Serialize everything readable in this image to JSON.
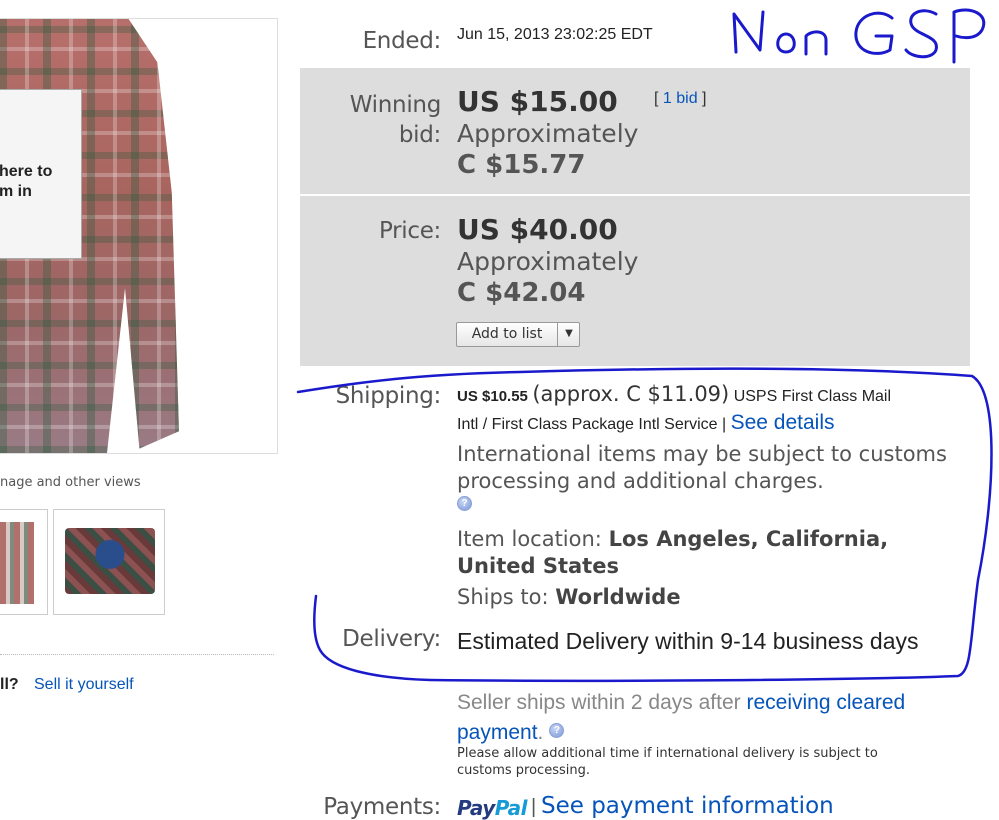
{
  "gallery": {
    "hover_line1": "here to",
    "hover_line2": "m in",
    "views_caption": "nage and other views"
  },
  "sell": {
    "question": "ll?",
    "link": "Sell it yourself"
  },
  "ended": {
    "label": "Ended:",
    "value": "Jun 15, 2013  23:02:25 EDT"
  },
  "bid": {
    "label_line1": "Winning",
    "label_line2": "bid:",
    "amount": "US $15.00",
    "bid_count_open": "[ ",
    "bid_count": "1 bid",
    "bid_count_close": " ]",
    "approx_label": "Approximately",
    "approx_value": "C $15.77"
  },
  "price": {
    "label": "Price:",
    "amount": "US $40.00",
    "approx_label": "Approximately",
    "approx_value": "C $42.04",
    "add_to_list": "Add to list"
  },
  "shipping": {
    "label": "Shipping:",
    "cost": "US $10.55",
    "approx": "(approx. C $11.09)",
    "service_part1": "USPS First Class Mail",
    "service_part2": "Intl / First Class Package Intl Service |",
    "see_details": "See details",
    "intl_note": "International items may be subject to customs processing and additional charges.",
    "location_label": "Item location:",
    "location_line1": "Los Angeles, California,",
    "location_line2": "United States",
    "ships_to_label": "Ships to:",
    "ships_to": "Worldwide"
  },
  "delivery": {
    "label": "Delivery:",
    "text": "Estimated Delivery within 9-14 business days",
    "seller_ships": "Seller ships within 2 days after",
    "cleared_payment": "receiving cleared payment",
    "period": ".",
    "allow_note": "Please allow additional time if international delivery is subject to customs processing."
  },
  "payments": {
    "label": "Payments:",
    "paypal_pay": "Pay",
    "paypal_pal": "Pal",
    "separator": "|",
    "link": "See payment information"
  },
  "annotation": {
    "handwritten": "Non GSP",
    "ink_color": "#1a1acc"
  },
  "colors": {
    "link": "#0654ba",
    "panel": "#dddddd"
  }
}
